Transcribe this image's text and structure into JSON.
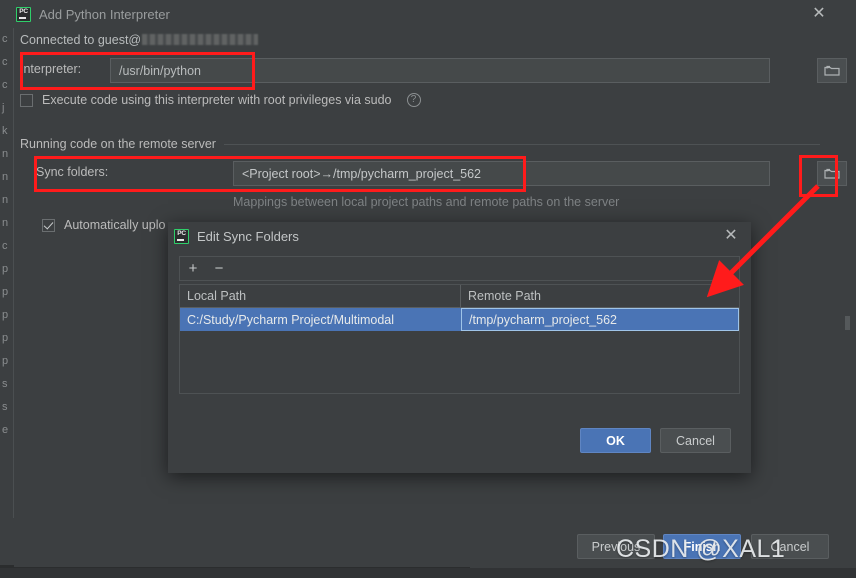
{
  "window": {
    "title": "Add Python Interpreter",
    "icon": "pycharm-icon",
    "close_label": "✕"
  },
  "main": {
    "connected_text": "Connected to guest@",
    "interpreter_label": "Interpreter:",
    "interpreter_value": "/usr/bin/python",
    "browse_icon": "folder-icon",
    "sudo_checkbox_label": "Execute code using this interpreter with root privileges via sudo",
    "sudo_checked": false,
    "help_icon": "question-mark-icon",
    "section_title": "Running code on the remote server",
    "sync_folders_label": "Sync folders:",
    "sync_folders_value": "<Project root>→/tmp/pycharm_project_562",
    "sync_hint": "Mappings between local project paths and remote paths on the server",
    "auto_upload_label": "Automatically uplo",
    "auto_upload_checked": true
  },
  "footer": {
    "previous_label": "Previous",
    "finish_label": "Finish",
    "cancel_label": "Cancel"
  },
  "modal": {
    "title": "Edit Sync Folders",
    "close_label": "✕",
    "add_label": "+",
    "remove_label": "−",
    "columns": [
      "Local Path",
      "Remote Path"
    ],
    "rows": [
      {
        "local_path": "C:/Study/Pycharm Project/Multimodal",
        "remote_path": "/tmp/pycharm_project_562"
      }
    ],
    "ok_label": "OK",
    "cancel_label": "Cancel"
  },
  "background_list": [
    "c",
    "c",
    "c",
    "j",
    "k",
    "n",
    "n",
    "n",
    "n",
    "c",
    "p",
    "p",
    "p",
    "p",
    "p",
    "s",
    "s",
    "e"
  ],
  "watermark": "CSDN @XAL1",
  "colors": {
    "window_bg": "#3c3f41",
    "field_bg": "#45494a",
    "selection_blue": "#4a74b5",
    "annotation_red": "#ff1b1b",
    "accent_green": "#2fcf6a"
  }
}
